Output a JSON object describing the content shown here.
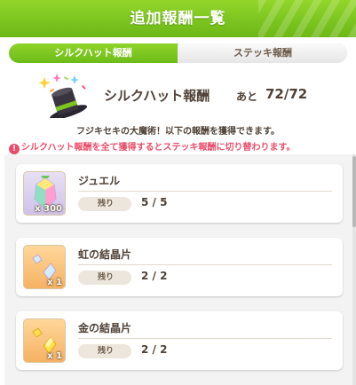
{
  "header": {
    "title": "追加報酬一覧"
  },
  "tabs": [
    {
      "label": "シルクハット報酬",
      "active": true
    },
    {
      "label": "ステッキ報酬",
      "active": false
    }
  ],
  "summary": {
    "icon": "silk-hat-icon",
    "title": "シルクハット報酬",
    "remaining_label": "あと",
    "remaining_value": "72/72"
  },
  "notes": {
    "line1": "フジキセキの大魔術！以下の報酬を獲得できます。",
    "line2": "シルクハット報酬を全て獲得するとステッキ報酬に切り替わります。",
    "warning_icon": "!"
  },
  "rewards": [
    {
      "name": "ジュエル",
      "icon": "jewel-icon",
      "quantity": "x 300",
      "remaining_label": "残り",
      "remaining": "5 / 5"
    },
    {
      "name": "虹の結晶片",
      "icon": "rainbow-crystal-icon",
      "quantity": "x 1",
      "remaining_label": "残り",
      "remaining": "2 / 2"
    },
    {
      "name": "金の結晶片",
      "icon": "gold-crystal-icon",
      "quantity": "x 1",
      "remaining_label": "残り",
      "remaining": "2 / 2"
    }
  ],
  "colors": {
    "header_green": "#7cc520",
    "warning_red": "#ea4d6a",
    "text_brown": "#4f4136"
  }
}
